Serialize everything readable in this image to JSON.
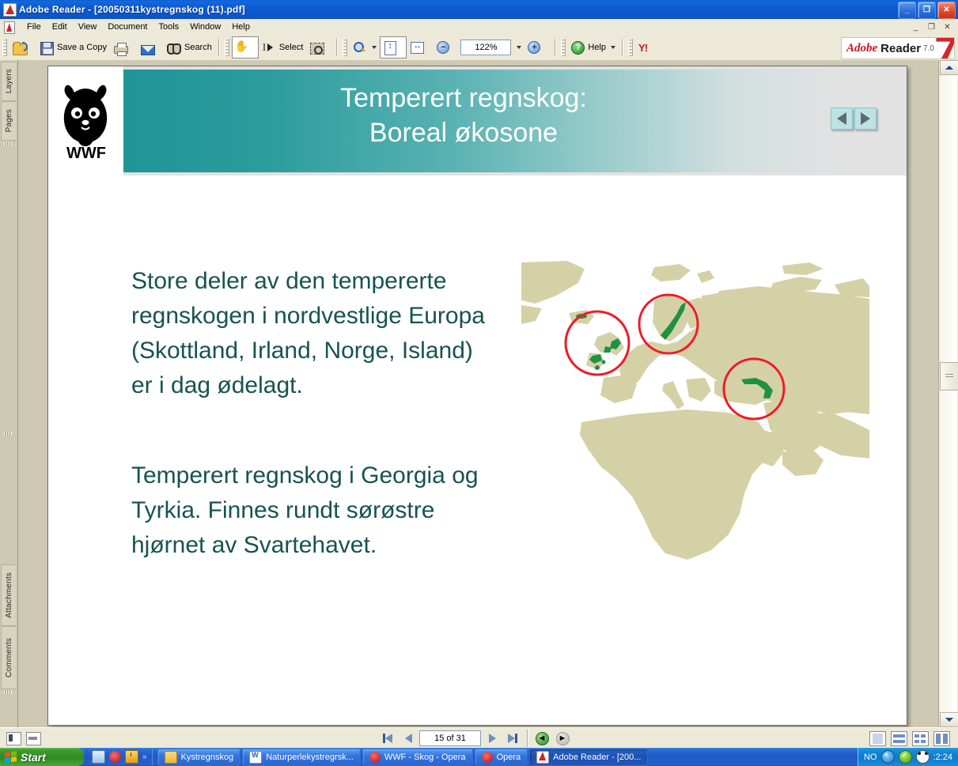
{
  "window": {
    "title": "Adobe Reader - [20050311kystregnskog (11).pdf]",
    "app_icon": "acrobat-icon",
    "minimize": "_",
    "maximize": "❐",
    "close": "✕"
  },
  "menubar": {
    "items": [
      {
        "label": "File"
      },
      {
        "label": "Edit"
      },
      {
        "label": "View"
      },
      {
        "label": "Document"
      },
      {
        "label": "Tools"
      },
      {
        "label": "Window"
      },
      {
        "label": "Help"
      }
    ],
    "mdi": {
      "minimize": "_",
      "restore": "❐",
      "close": "✕"
    }
  },
  "toolbar": {
    "open_label": "",
    "save_label": "Save a Copy",
    "print_label": "",
    "email_label": "",
    "search_label": "Search",
    "hand_label": "",
    "select_label": "Select",
    "snapshot_label": "",
    "zoom_tool_label": "",
    "fit_page_label": "",
    "fit_width_label": "",
    "zoom_out_label": "−",
    "zoom_value": "122%",
    "zoom_in_label": "+",
    "help_label": "Help",
    "yahoo_label": "Y!",
    "brand": {
      "adobe": "Adobe",
      "reader": "Reader",
      "version": "7.0"
    }
  },
  "navpane": {
    "tabs": [
      {
        "label": "Layers"
      },
      {
        "label": "Pages"
      },
      {
        "label": "Attachments"
      },
      {
        "label": "Comments"
      }
    ]
  },
  "slide": {
    "logo_alt": "WWF panda logo",
    "logo_text": "WWF",
    "title_line1": "Temperert regnskog:",
    "title_line2": "Boreal økosone",
    "nav_prev": "◀",
    "nav_next": "▶",
    "paragraph1": "Store deler av den tempererte regnskogen i nordvestlige Europa (Skottland, Irland, Norge, Island) er i dag ødelagt.",
    "paragraph2": "Temperert regnskog i Georgia og Tyrkia. Finnes rundt sørøstre hjørnet av Svartehavet.",
    "map": {
      "alt": "Map of Europe, North Africa and the Middle East with temperate rainforest areas highlighted in green and three red circles",
      "land_color": "#d5d1a7",
      "forest_color": "#1f9142",
      "circle_color": "#ee1c25",
      "highlight_regions": [
        "Scotland / Ireland / Iceland",
        "Norway",
        "Georgia / Turkey (Black Sea)"
      ]
    }
  },
  "statusbar": {
    "page_value": "15 of 31",
    "first_page": "first-page",
    "prev_page": "previous-page",
    "next_page": "next-page",
    "last_page": "last-page",
    "back": "previous-view",
    "forward": "next-view",
    "view_modes": [
      "single-page",
      "continuous",
      "facing",
      "continuous-facing"
    ]
  },
  "taskbar": {
    "start_label": "Start",
    "quick_launch": [
      "show-desktop-icon",
      "opera-icon",
      "clock-icon"
    ],
    "quick_more": "»",
    "items": [
      {
        "label": "Kystregnskog",
        "icon": "folder-icon",
        "active": false
      },
      {
        "label": "Naturperlekystregrsk...",
        "icon": "word-icon",
        "active": false
      },
      {
        "label": "WWF - Skog - Opera",
        "icon": "opera-icon",
        "active": false
      },
      {
        "label": "Opera",
        "icon": "opera-icon",
        "active": false
      },
      {
        "label": "Adobe Reader - [200...",
        "icon": "acrobat-icon",
        "active": true
      }
    ],
    "tray": {
      "language": "NO",
      "icons": [
        "network-icon",
        "antivirus-icon",
        "wwf-panda-icon"
      ],
      "clock": ":2:24"
    }
  }
}
